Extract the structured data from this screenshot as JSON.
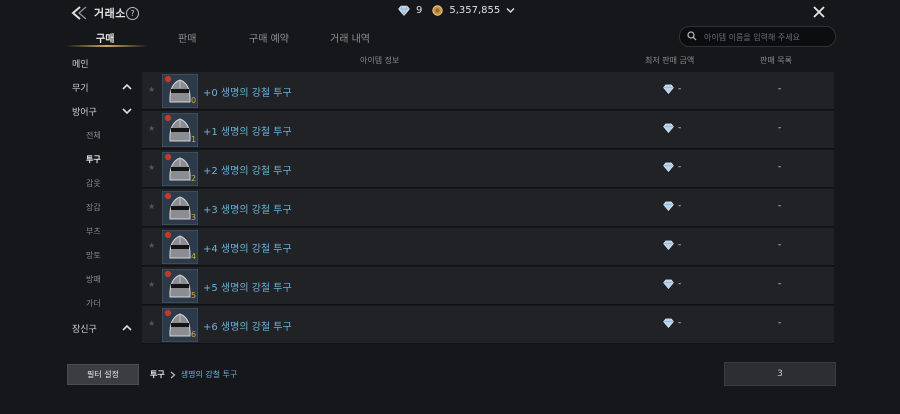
{
  "header": {
    "title": "거래소",
    "help_icon": "?",
    "diamond_count": "9",
    "gold_amount": "5,357,855"
  },
  "tabs": [
    {
      "label": "구매",
      "active": true
    },
    {
      "label": "판매",
      "active": false
    },
    {
      "label": "구매 예약",
      "active": false
    },
    {
      "label": "거래 내역",
      "active": false
    }
  ],
  "search": {
    "placeholder": "아이템 이름을 입력해 주세요"
  },
  "sidebar": {
    "main": "메인",
    "weapon": "무기",
    "armor": "방어구",
    "armor_subs": [
      "전체",
      "투구",
      "갑옷",
      "장갑",
      "부츠",
      "망토",
      "방패",
      "가더"
    ],
    "armor_active": "투구",
    "accessory": "장신구"
  },
  "table": {
    "headers": {
      "info": "아이템 정보",
      "min_price": "최저 판매 금액",
      "listings": "판매 목록"
    },
    "rows": [
      {
        "level": "0",
        "name": "+0 생명의 강철 투구",
        "price": "-",
        "count": "-"
      },
      {
        "level": "1",
        "name": "+1 생명의 강철 투구",
        "price": "-",
        "count": "-"
      },
      {
        "level": "2",
        "name": "+2 생명의 강철 투구",
        "price": "-",
        "count": "-"
      },
      {
        "level": "3",
        "name": "+3 생명의 강철 투구",
        "price": "-",
        "count": "-"
      },
      {
        "level": "4",
        "name": "+4 생명의 강철 투구",
        "price": "-",
        "count": "-"
      },
      {
        "level": "5",
        "name": "+5 생명의 강철 투구",
        "price": "-",
        "count": "-"
      },
      {
        "level": "6",
        "name": "+6 생명의 강철 투구",
        "price": "-",
        "count": "-"
      }
    ]
  },
  "footer": {
    "filter_label": "필터 설정",
    "breadcrumb_category": "투구",
    "breadcrumb_item": "생명의 강철 투구",
    "action_value": "3"
  },
  "colors": {
    "accent_gold": "#c9a868",
    "item_blue": "#6ab3d8"
  }
}
